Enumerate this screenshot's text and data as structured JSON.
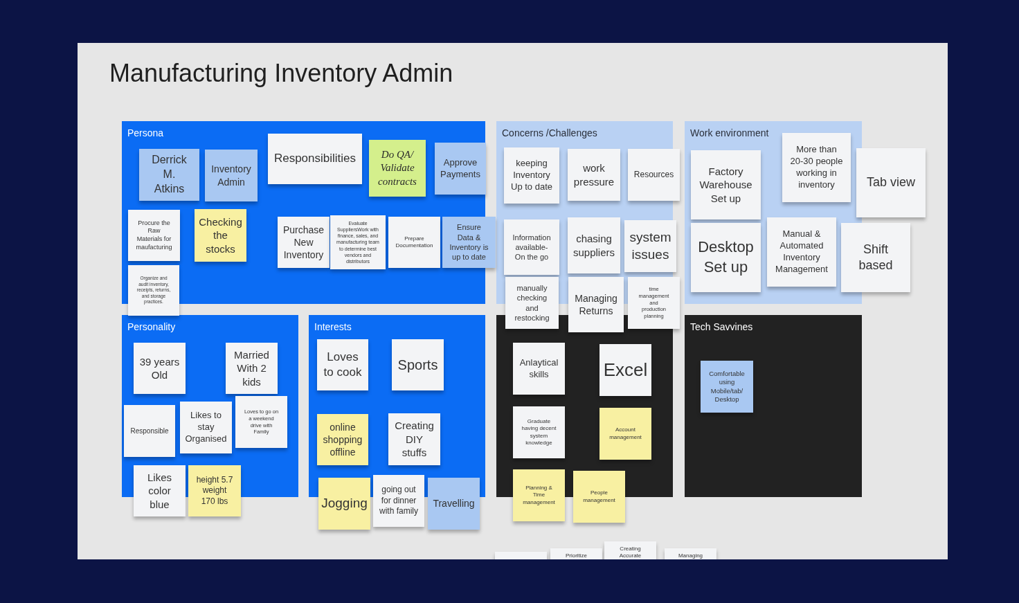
{
  "board": {
    "title": "Manufacturing Inventory Admin"
  },
  "frames": [
    {
      "title": "Persona",
      "color": "#0b6cf4",
      "notes": [
        {
          "text": "Derrick\nM.\nAtkins",
          "color": "#a9c8f2",
          "kind": "plain"
        },
        {
          "text": "Inventory\nAdmin",
          "color": "#a9c8f2",
          "kind": "plain"
        },
        {
          "text": "Responsibilities",
          "color": "#f3f4f6",
          "kind": "plain"
        },
        {
          "text": "Do QA/\nValidate\ncontracts",
          "color": "#d4ef8c",
          "kind": "handwritten"
        },
        {
          "text": "Approve\nPayments",
          "color": "#a9c8f2",
          "kind": "plain"
        },
        {
          "text": "Procure the\nRaw\nMaterials for\nmaufacturing",
          "color": "#f3f4f6",
          "kind": "plain"
        },
        {
          "text": "Checking\nthe\nstocks",
          "color": "#f8f0a2",
          "kind": "plain"
        },
        {
          "text": "Organize and\naudit inventory,\nreceipts, returns,\nand storage\npractices.",
          "color": "#f3f4f6",
          "kind": "plain"
        },
        {
          "text": "Purchase\nNew\nInventory",
          "color": "#f3f4f6",
          "kind": "plain"
        },
        {
          "text": "Evaluate\nSuppliersWork with\nfinance, sales, and\nmanufacturing team\nto determine best\nvendors and\ndistributors",
          "color": "#f3f4f6",
          "kind": "plain"
        },
        {
          "text": "Prepare\nDocumentation",
          "color": "#f3f4f6",
          "kind": "plain"
        },
        {
          "text": "Ensure\nData &\nInventory is\nup to date",
          "color": "#a9c8f2",
          "kind": "plain"
        }
      ]
    },
    {
      "title": "Concerns /Challenges",
      "color": "#b9d1f3",
      "notes": [
        {
          "text": "keeping\nInventory\nUp to date",
          "color": "#f3f4f6",
          "kind": "plain"
        },
        {
          "text": "work\npressure",
          "color": "#f3f4f6",
          "kind": "plain"
        },
        {
          "text": "Resources",
          "color": "#f3f4f6",
          "kind": "plain"
        },
        {
          "text": "Information\navailable-\nOn the go",
          "color": "#f3f4f6",
          "kind": "plain"
        },
        {
          "text": "chasing\nsuppliers",
          "color": "#f3f4f6",
          "kind": "plain"
        },
        {
          "text": "system\nissues",
          "color": "#f3f4f6",
          "kind": "plain"
        },
        {
          "text": "manually\nchecking\nand\nrestocking",
          "color": "#f3f4f6",
          "kind": "plain"
        },
        {
          "text": "Managing\nReturns",
          "color": "#f3f4f6",
          "kind": "plain"
        },
        {
          "text": "time\nmanagement\nand\nproduction\nplanning",
          "color": "#f3f4f6",
          "kind": "plain"
        }
      ]
    },
    {
      "title": "Work environment",
      "color": "#b9d1f3",
      "notes": [
        {
          "text": "Factory\nWarehouse\nSet up",
          "color": "#f3f4f6",
          "kind": "plain"
        },
        {
          "text": "More than\n20-30 people\nworking in\ninventory",
          "color": "#f3f4f6",
          "kind": "plain"
        },
        {
          "text": "Tab view",
          "color": "#f3f4f6",
          "kind": "plain"
        },
        {
          "text": "Desktop\nSet up",
          "color": "#f3f4f6",
          "kind": "plain"
        },
        {
          "text": "Manual &\nAutomated\nInventory\nManagement",
          "color": "#f3f4f6",
          "kind": "plain"
        },
        {
          "text": "Shift\nbased",
          "color": "#f3f4f6",
          "kind": "plain"
        }
      ]
    },
    {
      "title": "Personality",
      "color": "#0b6cf4",
      "notes": [
        {
          "text": "39 years\nOld",
          "color": "#f3f4f6",
          "kind": "plain"
        },
        {
          "text": "Married\nWith 2\nkids",
          "color": "#f3f4f6",
          "kind": "plain"
        },
        {
          "text": "Responsible",
          "color": "#f3f4f6",
          "kind": "plain"
        },
        {
          "text": "Likes to\nstay\nOrganised",
          "color": "#f3f4f6",
          "kind": "plain"
        },
        {
          "text": "Loves to go on\na weekend\ndrive with\nFamily",
          "color": "#f3f4f6",
          "kind": "plain"
        },
        {
          "text": "Likes\ncolor\nblue",
          "color": "#f3f4f6",
          "kind": "plain"
        },
        {
          "text": "height 5.7\nweight\n170 lbs",
          "color": "#f8f0a2",
          "kind": "plain"
        }
      ]
    },
    {
      "title": "Interests",
      "color": "#0b6cf4",
      "notes": [
        {
          "text": "Loves\nto cook",
          "color": "#f3f4f6",
          "kind": "plain"
        },
        {
          "text": "Sports",
          "color": "#f3f4f6",
          "kind": "plain"
        },
        {
          "text": "online\nshopping\noffline",
          "color": "#f8f0a2",
          "kind": "plain"
        },
        {
          "text": "Creating\nDIY\nstuffs",
          "color": "#f3f4f6",
          "kind": "plain"
        },
        {
          "text": "Jogging",
          "color": "#f8f0a2",
          "kind": "plain"
        },
        {
          "text": "going out\nfor dinner\nwith family",
          "color": "#f3f4f6",
          "kind": "plain"
        },
        {
          "text": "Travelling",
          "color": "#a9c8f2",
          "kind": "plain"
        }
      ]
    },
    {
      "color": "#222222",
      "notes": [
        {
          "text": "Anlaytical\nskills",
          "color": "#f3f4f6",
          "kind": "plain"
        },
        {
          "text": "Excel",
          "color": "#f3f4f6",
          "kind": "plain"
        },
        {
          "text": "Graduate\nhaving decent\nsystem\nknowledge",
          "color": "#f3f4f6",
          "kind": "plain"
        },
        {
          "text": "Account\nmanagement",
          "color": "#f8f0a2",
          "kind": "plain"
        },
        {
          "text": "Planning &\nTime\nmanagement",
          "color": "#f8f0a2",
          "kind": "plain"
        },
        {
          "text": "People\nmanagement",
          "color": "#f8f0a2",
          "kind": "plain"
        }
      ]
    },
    {
      "title": "Tech Savvines",
      "color": "#222222",
      "notes": [
        {
          "text": "Comfortable\nusing\nMobile/tab/\nDesktop",
          "color": "#a9c8f2",
          "kind": "plain"
        }
      ]
    }
  ],
  "loose_notes": [
    {
      "color": "#f3f4f6",
      "kind": "plain"
    },
    {
      "text": "Prioritize",
      "color": "#f3f4f6",
      "kind": "clipped"
    },
    {
      "text": "Creating\nAccurate",
      "color": "#f3f4f6",
      "kind": "clipped"
    },
    {
      "text": "Managing",
      "color": "#f3f4f6",
      "kind": "clipped"
    }
  ]
}
